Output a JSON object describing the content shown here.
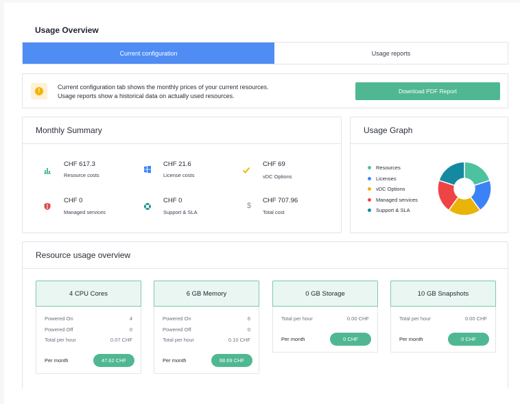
{
  "page": {
    "title": "Usage Overview"
  },
  "tabs": [
    {
      "label": "Current configuration",
      "active": true
    },
    {
      "label": "Usage reports",
      "active": false
    }
  ],
  "info": {
    "line1": "Current configuration tab shows the monthly prices of your current resources.",
    "line2": "Usage reports show a historical data on actually used resources.",
    "icon": "info-icon",
    "download_label": "Download PDF Report"
  },
  "summary": {
    "title": "Monthly Summary",
    "items": [
      {
        "value": "CHF 617.3",
        "label": "Resource costs",
        "icon": "bar-chart-icon",
        "color": "#4fb893"
      },
      {
        "value": "CHF 21.6",
        "label": "License costs",
        "icon": "windows-icon",
        "color": "#3b82f6"
      },
      {
        "value": "CHF 69",
        "label": "vDC Options",
        "icon": "check-icon",
        "color": "#e6b400"
      },
      {
        "value": "CHF 0",
        "label": "Managed services",
        "icon": "shield-icon",
        "color": "#e04a4a"
      },
      {
        "value": "CHF 0",
        "label": "Support & SLA",
        "icon": "lifebuoy-icon",
        "color": "#1d8a8a"
      },
      {
        "value": "CHF 707.96",
        "label": "Total cost",
        "icon": "dollar-icon",
        "color": "#8a8f9c"
      }
    ]
  },
  "graph": {
    "title": "Usage Graph",
    "legend": [
      {
        "label": "Resources",
        "color": "#4cc2a0"
      },
      {
        "label": "Licenses",
        "color": "#3b82f6"
      },
      {
        "label": "vDC Options",
        "color": "#eab308"
      },
      {
        "label": "Managed services",
        "color": "#ef4444"
      },
      {
        "label": "Support & SLA",
        "color": "#1589a0"
      }
    ],
    "slices": [
      20,
      20,
      20,
      20,
      20
    ]
  },
  "resource": {
    "title": "Resource usage overview",
    "cards": [
      {
        "title": "4 CPU Cores",
        "rows": [
          {
            "label": "Powered On",
            "value": "4"
          },
          {
            "label": "Powered Off",
            "value": "0"
          },
          {
            "label": "Total per hour",
            "value": "0.07 CHF"
          }
        ],
        "month_label": "Per month",
        "month_value": "47.62 CHF"
      },
      {
        "title": "6 GB Memory",
        "rows": [
          {
            "label": "Powered On",
            "value": "6"
          },
          {
            "label": "Powered Off",
            "value": "0"
          },
          {
            "label": "Total per hour",
            "value": "0.10 CHF"
          }
        ],
        "month_label": "Per month",
        "month_value": "68.69 CHF"
      },
      {
        "title": "0 GB Storage",
        "rows": [
          {
            "label": "Total per hour",
            "value": "0.00 CHF"
          }
        ],
        "month_label": "Per month",
        "month_value": "0 CHF"
      },
      {
        "title": "10 GB Snapshots",
        "rows": [
          {
            "label": "Total per hour",
            "value": "0.00 CHF"
          }
        ],
        "month_label": "Per month",
        "month_value": "0 CHF"
      }
    ]
  }
}
